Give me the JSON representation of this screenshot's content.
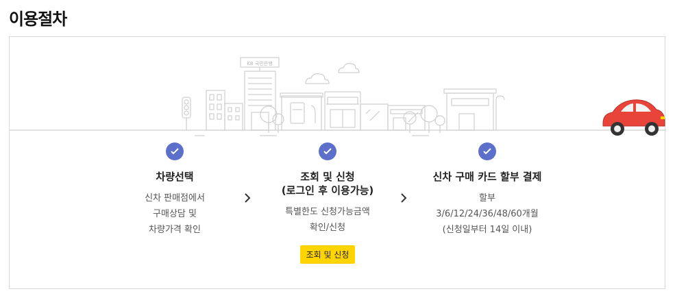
{
  "page": {
    "title": "이용절차"
  },
  "scene": {
    "bank_sign": "KB 국민은행"
  },
  "steps": [
    {
      "title": "차량선택",
      "desc": [
        "신차 판매점에서",
        "구매상담 및",
        "차량가격 확인"
      ]
    },
    {
      "title": "조회 및 신청",
      "title2": "(로그인 후 이용가능)",
      "desc": [
        "특별한도 신청가능금액",
        "확인/신청"
      ],
      "button": "조회 및 신청"
    },
    {
      "title": "신차 구매 카드 할부 결제",
      "desc": [
        "할부",
        "3/6/12/24/36/48/60개월",
        "(신청일부터 14일 이내)"
      ]
    }
  ],
  "colors": {
    "check": "#5b6fcb",
    "button": "#ffd400",
    "car": "#e8443a"
  }
}
